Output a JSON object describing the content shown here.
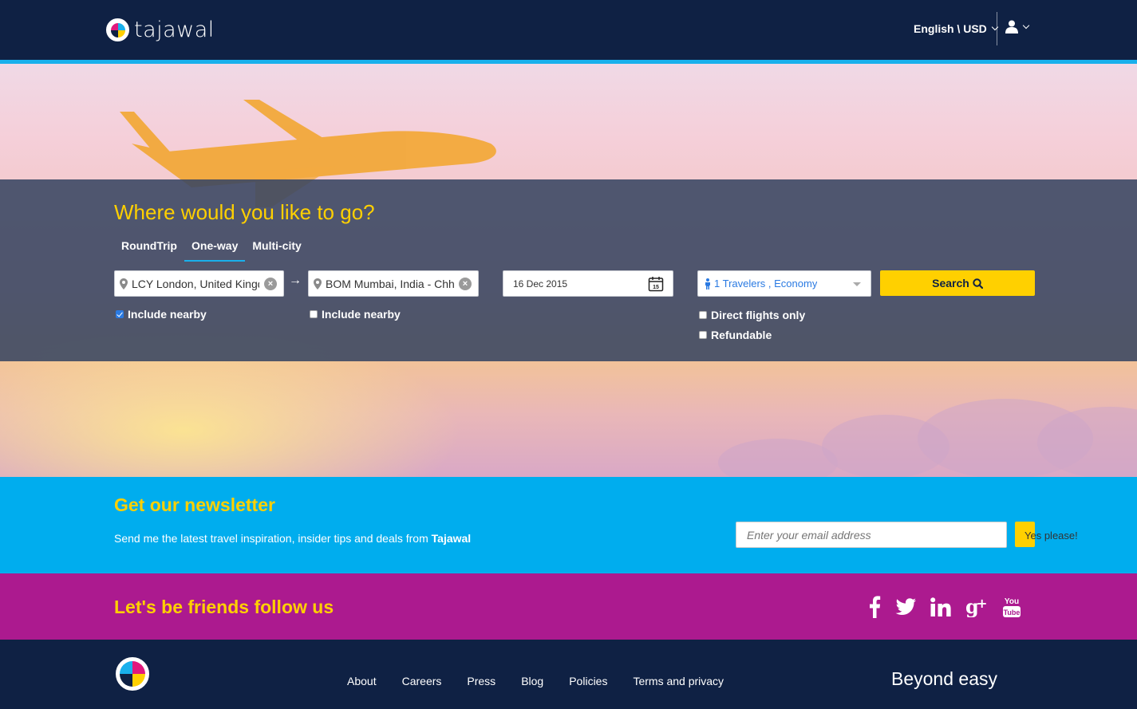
{
  "header": {
    "brand": "tajawal",
    "language_currency": "English \\ USD"
  },
  "search": {
    "title": "Where would you like to go?",
    "tabs": [
      {
        "label": "RoundTrip",
        "active": false
      },
      {
        "label": "One-way",
        "active": true
      },
      {
        "label": "Multi-city",
        "active": false
      }
    ],
    "origin": {
      "value": "LCY London, United Kingdom",
      "include_nearby_label": "Include nearby",
      "include_nearby_checked": true
    },
    "destination": {
      "value": "BOM Mumbai, India - Chhatrapati",
      "include_nearby_label": "Include nearby",
      "include_nearby_checked": false
    },
    "date": "16 Dec 2015",
    "calendar_day": "15",
    "travelers": "1 Travelers , Economy",
    "direct_flights_label": "Direct flights only",
    "refundable_label": "Refundable",
    "search_button": "Search"
  },
  "newsletter": {
    "title": "Get our newsletter",
    "subtitle_prefix": "Send me the latest travel inspiration, insider tips and deals from ",
    "subtitle_brand": "Tajawal",
    "email_placeholder": "Enter your email address",
    "button_label": "Yes please!"
  },
  "social": {
    "title": "Let's be friends follow us",
    "icons": [
      "facebook-icon",
      "twitter-icon",
      "linkedin-icon",
      "google-plus-icon",
      "youtube-icon"
    ],
    "youtube_top": "You",
    "youtube_bottom": "Tube"
  },
  "footer": {
    "links": [
      "About",
      "Careers",
      "Press",
      "Blog",
      "Policies",
      "Terms and privacy"
    ],
    "tagline": "Beyond easy"
  },
  "colors": {
    "navy": "#0f2144",
    "accent_blue": "#00adee",
    "yellow": "#ffd000",
    "magenta": "#ac1a8f"
  }
}
